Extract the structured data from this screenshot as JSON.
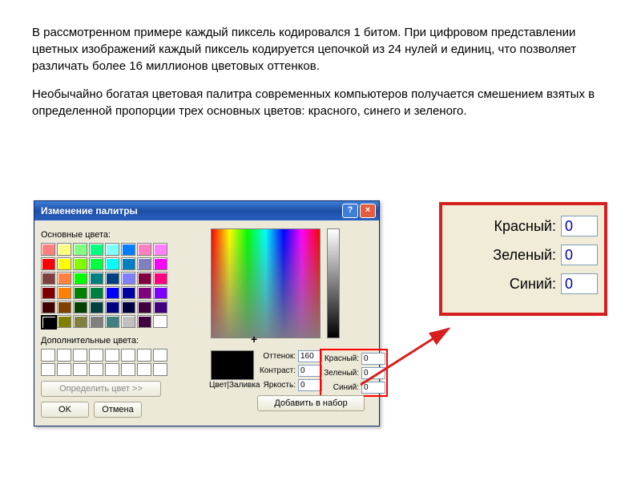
{
  "text": {
    "p1": "В рассмотренном примере каждый пиксель кодировался 1 битом. При цифровом представлении цветных изображений каждый пиксель кодируется цепочкой из 24 нулей и единиц, что позволяет различать более 16 миллионов цветовых оттенков.",
    "p2": "Необычайно богатая цветовая палитра современных компьютеров получается смешением взятых в определенной пропорции трех основных цветов: красного, синего и зеленого."
  },
  "dialog": {
    "title": "Изменение палитры",
    "labels": {
      "basic": "Основные цвета:",
      "custom": "Дополнительные цвета:",
      "define": "Определить цвет >>",
      "ok": "OK",
      "cancel": "Отмена",
      "color_solid": "Цвет|Заливка",
      "hue": "Оттенок:",
      "sat": "Контраст:",
      "lum": "Яркость:",
      "red": "Красный:",
      "green": "Зеленый:",
      "blue": "Синий:",
      "add": "Добавить в набор"
    },
    "values": {
      "hue": "160",
      "sat": "0",
      "lum": "0",
      "red": "0",
      "green": "0",
      "blue": "0"
    },
    "basic_colors": [
      "#ff8080",
      "#ffff80",
      "#80ff80",
      "#00ff80",
      "#80ffff",
      "#0080ff",
      "#ff80c0",
      "#ff80ff",
      "#ff0000",
      "#ffff00",
      "#80ff00",
      "#00ff40",
      "#00ffff",
      "#0080c0",
      "#8080c0",
      "#ff00ff",
      "#804040",
      "#ff8040",
      "#00ff00",
      "#008080",
      "#004080",
      "#8080ff",
      "#800040",
      "#ff0080",
      "#800000",
      "#ff8000",
      "#008000",
      "#008040",
      "#0000ff",
      "#0000a0",
      "#800080",
      "#8000ff",
      "#400000",
      "#804000",
      "#004000",
      "#004040",
      "#000080",
      "#000040",
      "#400040",
      "#400080",
      "#000000",
      "#808000",
      "#808040",
      "#808080",
      "#408080",
      "#c0c0c0",
      "#400040",
      "#ffffff"
    ]
  },
  "zoom": {
    "red_label": "Красный:",
    "green_label": "Зеленый:",
    "blue_label": "Синий:",
    "red": "0",
    "green": "0",
    "blue": "0"
  }
}
